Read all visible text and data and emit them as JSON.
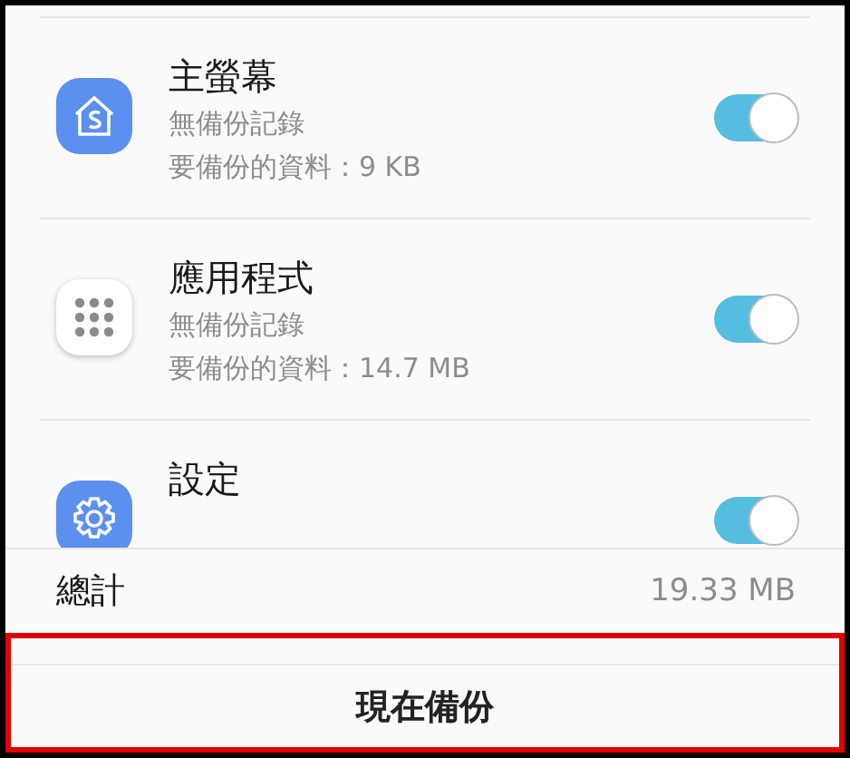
{
  "items": [
    {
      "title": "主螢幕",
      "lines": [
        "無備份記錄",
        "要備份的資料：9 KB"
      ],
      "on": true
    },
    {
      "title": "應用程式",
      "lines": [
        "無備份記錄",
        "要備份的資料：14.7 MB"
      ],
      "on": true
    },
    {
      "title": "設定",
      "on": true
    }
  ],
  "total": {
    "label": "總計",
    "value": "19.33 MB"
  },
  "button": {
    "label": "現在備份"
  }
}
